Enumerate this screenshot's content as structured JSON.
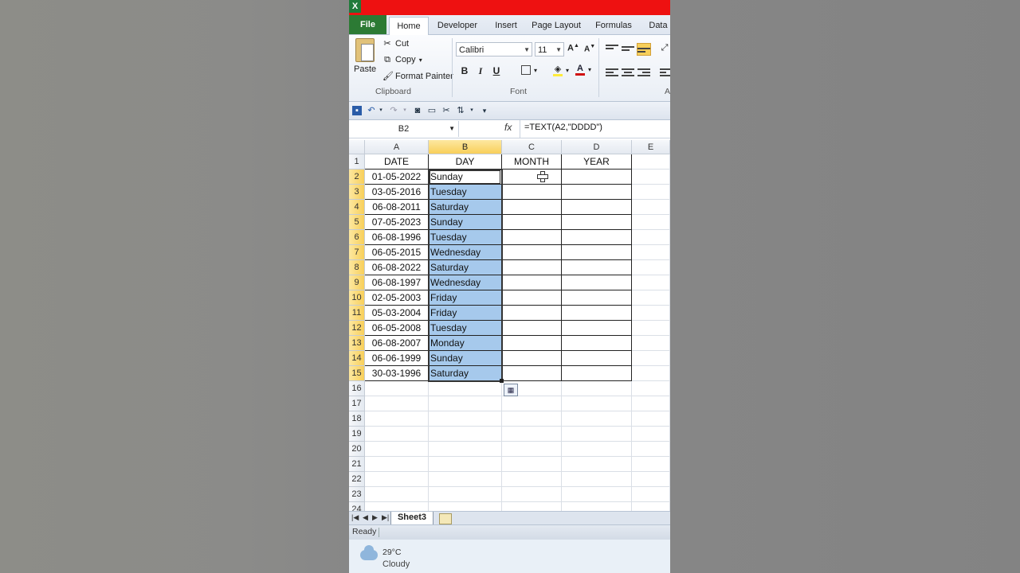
{
  "window": {
    "app_icon": "excel-icon",
    "title_bar_color": "#ee1111"
  },
  "tabs": [
    {
      "label": "File"
    },
    {
      "label": "Home"
    },
    {
      "label": "Developer"
    },
    {
      "label": "Insert"
    },
    {
      "label": "Page Layout"
    },
    {
      "label": "Formulas"
    },
    {
      "label": "Data"
    }
  ],
  "clipboard": {
    "paste_label": "Paste",
    "cut_label": "Cut",
    "copy_label": "Copy",
    "format_painter_label": "Format Painter",
    "group_label": "Clipboard"
  },
  "font": {
    "name": "Calibri",
    "size": "11",
    "group_label": "Font",
    "bold_label": "B",
    "italic_label": "I",
    "underline_label": "U",
    "font_color": "#d01010",
    "fill_color": "#ffeb3b"
  },
  "alignment": {
    "group_label": "A"
  },
  "formula_bar": {
    "name_box": "B2",
    "fx_label": "fx",
    "formula": "=TEXT(A2,\"DDDD\")"
  },
  "grid": {
    "columns": [
      "A",
      "B",
      "C",
      "D",
      "E"
    ],
    "selected_column": "B",
    "row_numbers": [
      "1",
      "2",
      "3",
      "4",
      "5",
      "6",
      "7",
      "8",
      "9",
      "10",
      "11",
      "12",
      "13",
      "14",
      "15",
      "16",
      "17",
      "18",
      "19",
      "20",
      "21",
      "22",
      "23",
      "24"
    ],
    "headers": [
      "DATE",
      "DAY",
      "MONTH",
      "YEAR"
    ],
    "rows": [
      {
        "date": "01-05-2022",
        "day": "Sunday"
      },
      {
        "date": "03-05-2016",
        "day": "Tuesday"
      },
      {
        "date": "06-08-2011",
        "day": "Saturday"
      },
      {
        "date": "07-05-2023",
        "day": "Sunday"
      },
      {
        "date": "06-08-1996",
        "day": "Tuesday"
      },
      {
        "date": "06-05-2015",
        "day": "Wednesday"
      },
      {
        "date": "06-08-2022",
        "day": "Saturday"
      },
      {
        "date": "06-08-1997",
        "day": "Wednesday"
      },
      {
        "date": "02-05-2003",
        "day": "Friday"
      },
      {
        "date": "05-03-2004",
        "day": "Friday"
      },
      {
        "date": "06-05-2008",
        "day": "Tuesday"
      },
      {
        "date": "06-08-2007",
        "day": "Monday"
      },
      {
        "date": "06-06-1999",
        "day": "Sunday"
      },
      {
        "date": "30-03-1996",
        "day": "Saturday"
      }
    ]
  },
  "sheets": {
    "active": "Sheet3"
  },
  "status": {
    "text": "Ready"
  },
  "weather": {
    "temperature": "29°C",
    "condition": "Cloudy"
  }
}
